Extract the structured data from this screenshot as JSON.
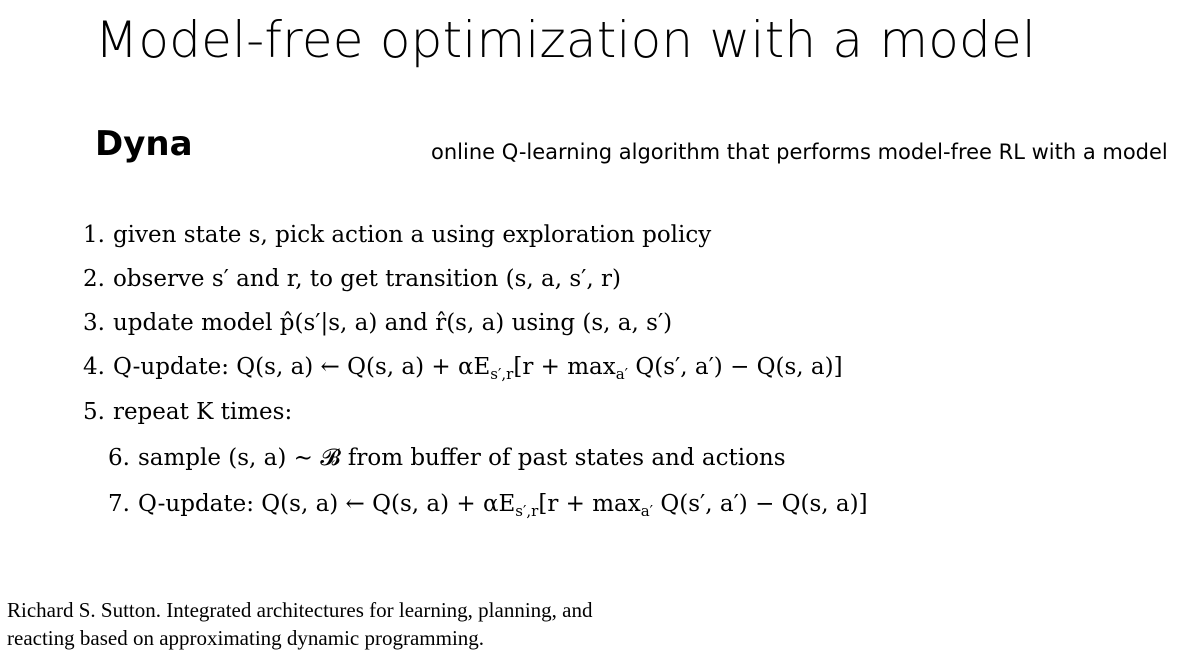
{
  "slide": {
    "title": "Model-free optimization with a model",
    "subtitle": "Dyna",
    "note": "online Q-learning algorithm that performs model-free RL with a model"
  },
  "steps": [
    {
      "num": "1.",
      "text": "given state s, pick action a using exploration policy"
    },
    {
      "num": "2.",
      "text": "observe s′ and r, to get transition (s, a, s′, r)"
    },
    {
      "num": "3.",
      "text": "update model p̂(s′|s, a) and r̂(s, a) using (s, a, s′)"
    },
    {
      "num": "4.",
      "text": "Q-update: Q(s, a) ← Q(s, a) + αE"
    },
    {
      "num": "5.",
      "text": "repeat K times:"
    },
    {
      "num": "6.",
      "text": "sample (s, a) ∼ 𝓑 from buffer of past states and actions"
    },
    {
      "num": "7.",
      "text": "Q-update: Q(s, a) ← Q(s, a) + αE"
    }
  ],
  "qupdate": {
    "subscript": "s′,r",
    "tail": "[r + max",
    "max_sub": "a′",
    "end": " Q(s′, a′) − Q(s, a)]"
  },
  "reference": {
    "line1": "Richard S. Sutton. Integrated architectures for learning, planning, and",
    "line2": "reacting based on approximating dynamic programming."
  }
}
